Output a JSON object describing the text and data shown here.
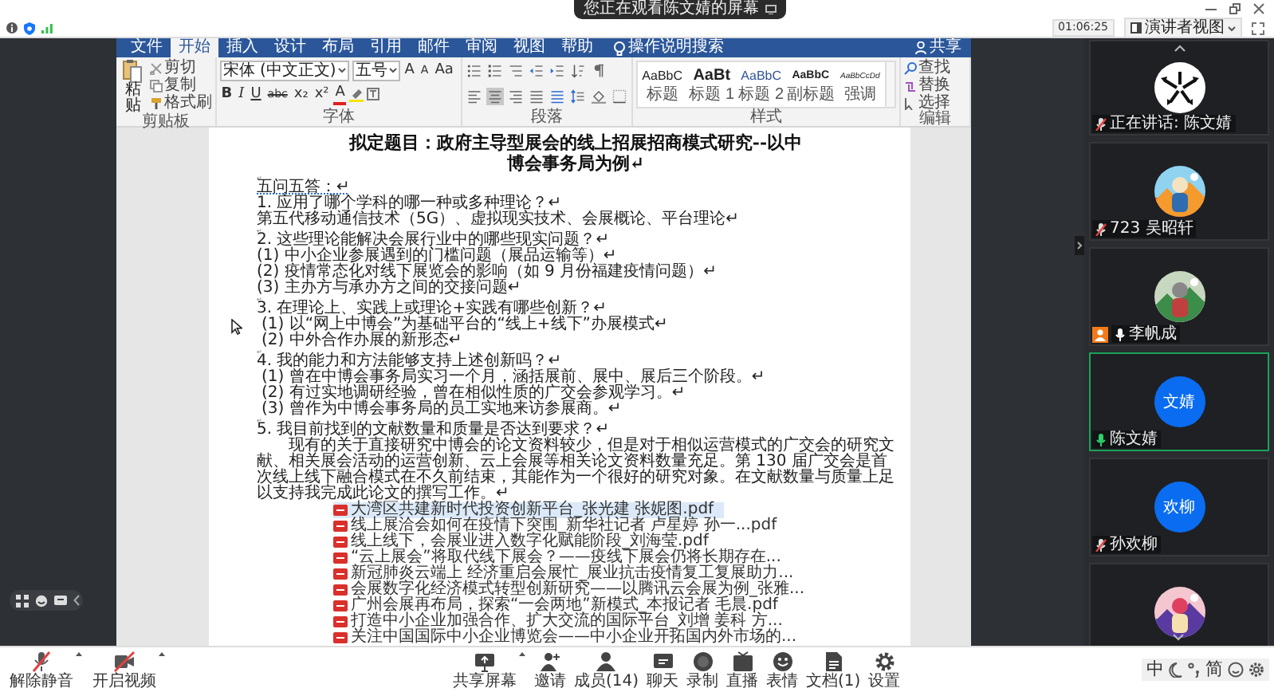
{
  "notice": {
    "text": "您正在观看陈文婧的屏幕"
  },
  "status": {
    "timer": "01:06:25",
    "view_button": "演讲者视图"
  },
  "word": {
    "tabs": [
      {
        "label": "文件",
        "selected": false
      },
      {
        "label": "开始",
        "selected": true
      },
      {
        "label": "插入",
        "selected": false
      },
      {
        "label": "设计",
        "selected": false
      },
      {
        "label": "布局",
        "selected": false
      },
      {
        "label": "引用",
        "selected": false
      },
      {
        "label": "邮件",
        "selected": false
      },
      {
        "label": "审阅",
        "selected": false
      },
      {
        "label": "视图",
        "selected": false
      },
      {
        "label": "帮助",
        "selected": false
      }
    ],
    "tell_me": "操作说明搜索",
    "share": "共享",
    "clipboard": {
      "paste": "粘贴",
      "actions": [
        {
          "label": "剪切",
          "kind": "cut"
        },
        {
          "label": "复制",
          "kind": "copy"
        },
        {
          "label": "格式刷",
          "kind": "painter"
        }
      ],
      "group": "剪贴板"
    },
    "font": {
      "name": "宋体 (中文正文)",
      "size": "五号",
      "size_buttons": [
        {
          "text": "A",
          "kind": "grow"
        },
        {
          "text": "A",
          "kind": "shrink"
        },
        {
          "text": "Aa",
          "kind": "case"
        }
      ],
      "format_buttons": [
        {
          "text": "B",
          "kind": "bold"
        },
        {
          "text": "I",
          "kind": "italic"
        },
        {
          "text": "U",
          "kind": "underline"
        },
        {
          "text": "abc",
          "kind": "strike"
        },
        {
          "text": "x₂",
          "kind": "sub"
        },
        {
          "text": "x²",
          "kind": "sup"
        },
        {
          "text": "A",
          "kind": "font-color"
        }
      ],
      "group": "字体"
    },
    "paragraph": {
      "rows": [
        [
          {
            "kind": "bullets",
            "selected": false
          },
          {
            "kind": "numbering",
            "selected": false
          },
          {
            "kind": "multilevel",
            "selected": false
          },
          {
            "kind": "outdent",
            "selected": false
          },
          {
            "kind": "indent",
            "selected": false
          },
          {
            "kind": "sort",
            "selected": false
          },
          {
            "kind": "pilcrow",
            "selected": false
          }
        ],
        [
          {
            "kind": "align-left",
            "selected": false
          },
          {
            "kind": "align-center",
            "selected": true
          },
          {
            "kind": "align-right",
            "selected": false
          },
          {
            "kind": "justify",
            "selected": false
          },
          {
            "kind": "distribute",
            "selected": false
          },
          {
            "kind": "spacing",
            "selected": false
          },
          {
            "kind": "shading",
            "selected": false
          },
          {
            "kind": "borders",
            "selected": false
          }
        ]
      ],
      "group": "段落"
    },
    "styles": {
      "items": [
        {
          "preview": "AaBbC",
          "label": "标题",
          "kind": "title"
        },
        {
          "preview": "AaBt",
          "label": "标题 1",
          "kind": "heading1"
        },
        {
          "preview": "AaBbC",
          "label": "标题 2",
          "kind": "heading2"
        },
        {
          "preview": "AaBbC",
          "label": "副标题",
          "kind": "subtitle"
        },
        {
          "preview": "AaBbCcDd",
          "label": "强调",
          "kind": "emphasis"
        }
      ],
      "group": "样式"
    },
    "editing": {
      "actions": [
        {
          "label": "查找",
          "kind": "find"
        },
        {
          "label": "替换",
          "kind": "replace"
        },
        {
          "label": "选择",
          "kind": "select"
        }
      ],
      "group": "编辑"
    }
  },
  "document": {
    "title": [
      "拟定题目：政府主导型展会的线上招展招商模式研究--以中",
      "博会事务局为例↵"
    ],
    "blocks": [
      {
        "kind": "blank",
        "text": "↵"
      },
      {
        "kind": "link",
        "text": "五问五答：↵"
      },
      {
        "kind": "line",
        "text": "1. 应用了哪个学科的哪一种或多种理论？↵"
      },
      {
        "kind": "line",
        "text": "第五代移动通信技术（5G）、虚拟现实技术、会展概论、平台理论↵"
      },
      {
        "kind": "blank",
        "text": "↵"
      },
      {
        "kind": "line",
        "text": "2. 这些理论能解决会展行业中的哪些现实问题？↵"
      },
      {
        "kind": "line",
        "text": "(1) 中小企业参展遇到的门槛问题（展品运输等）↵"
      },
      {
        "kind": "line",
        "text": "(2) 疫情常态化对线下展览会的影响（如 9 月份福建疫情问题）↵"
      },
      {
        "kind": "line",
        "text": "(3) 主办方与承办方之间的交接问题↵"
      },
      {
        "kind": "blank",
        "text": "↵"
      },
      {
        "kind": "line",
        "text": "3. 在理论上、实践上或理论+实践有哪些创新？↵"
      },
      {
        "kind": "item",
        "text": "(1) 以“网上中博会”为基础平台的“线上+线下”办展模式↵"
      },
      {
        "kind": "item",
        "text": "(2) 中外合作办展的新形态↵"
      },
      {
        "kind": "blank",
        "text": "↵"
      },
      {
        "kind": "line",
        "text": "4. 我的能力和方法能够支持上述创新吗？↵"
      },
      {
        "kind": "item",
        "text": "(1) 曾在中博会事务局实习一个月，涵括展前、展中、展后三个阶段。↵"
      },
      {
        "kind": "item",
        "text": "(2) 有过实地调研经验，曾在相似性质的广交会参观学习。↵"
      },
      {
        "kind": "item",
        "text": "(3) 曾作为中博会事务局的员工实地来访参展商。↵"
      },
      {
        "kind": "blank",
        "text": "↵"
      },
      {
        "kind": "line",
        "text": "5. 我目前找到的文献数量和质量是否达到要求？↵"
      },
      {
        "kind": "paragraph",
        "text": "现有的关于直接研究中博会的论文资料较少，但是对于相似运营模式的广交会的研究文献、相关展会活动的运营创新、云上会展等相关论文资料数量充足。第 130 届广交会是首次线上线下融合模式在不久前结束，其能作为一个很好的研究对象。在文献数量与质量上足以支持我完成此论文的撰写工作。↵"
      }
    ],
    "attachments": [
      {
        "name": "大湾区共建新时代投资创新平台_张光建 张妮图.pdf",
        "selected": true
      },
      {
        "name": "线上展洽会如何在疫情下突围_新华社记者 卢星婷 孙一...pdf",
        "selected": false
      },
      {
        "name": "线上线下，会展业进入数字化赋能阶段_刘海莹.pdf",
        "selected": false
      },
      {
        "name": "“云上展会”将取代线下展会？——疫线下展会仍将长期存在...",
        "selected": false
      },
      {
        "name": "新冠肺炎云端上 经济重启会展忙_展业抗击疫情复工复展助力...",
        "selected": false
      },
      {
        "name": "会展数字化经济模式转型创新研究——以腾讯云会展为例_张雅...",
        "selected": false
      },
      {
        "name": "广州会展再布局，探索“一会两地”新模式_本报记者 毛晨.pdf",
        "selected": false
      },
      {
        "name": "打造中小企业加强合作、扩大交流的国际平台_刘增 姜科 方...",
        "selected": false
      },
      {
        "name": "关注中国国际中小企业博览会——中小企业开拓国内外市场的...",
        "selected": false
      }
    ]
  },
  "participants": {
    "tiles": [
      {
        "kind": "logo",
        "name": "正在讲话: 陈文婧",
        "muted": true,
        "speaking": false,
        "host": false,
        "active": false
      },
      {
        "kind": "picture",
        "name": "723 吴昭轩",
        "muted": true,
        "speaking": false,
        "host": false,
        "active": false
      },
      {
        "kind": "picture",
        "name": "李帆成",
        "muted": false,
        "speaking": false,
        "host": true,
        "active": false
      },
      {
        "kind": "initials",
        "initials": "文婧",
        "name": "陈文婧",
        "muted": false,
        "speaking": true,
        "host": false,
        "active": true
      },
      {
        "kind": "initials",
        "initials": "欢柳",
        "name": "孙欢柳",
        "muted": true,
        "speaking": false,
        "host": false,
        "active": false
      },
      {
        "kind": "picture",
        "active": false
      }
    ]
  },
  "toolbar": {
    "left": [
      {
        "label": "解除静音",
        "kind": "mic-off"
      },
      {
        "label": "开启视频",
        "kind": "video-off"
      }
    ],
    "center": [
      {
        "label": "共享屏幕",
        "kind": "share"
      },
      {
        "label": "邀请",
        "kind": "invite"
      },
      {
        "label": "成员(14)",
        "kind": "members"
      },
      {
        "label": "聊天",
        "kind": "chat"
      },
      {
        "label": "录制",
        "kind": "record"
      },
      {
        "label": "直播",
        "kind": "live"
      },
      {
        "label": "表情",
        "kind": "reaction"
      },
      {
        "label": "文档(1)",
        "kind": "docs"
      },
      {
        "label": "设置",
        "kind": "settings"
      }
    ]
  },
  "ime": {
    "language": "中",
    "script": "简"
  }
}
